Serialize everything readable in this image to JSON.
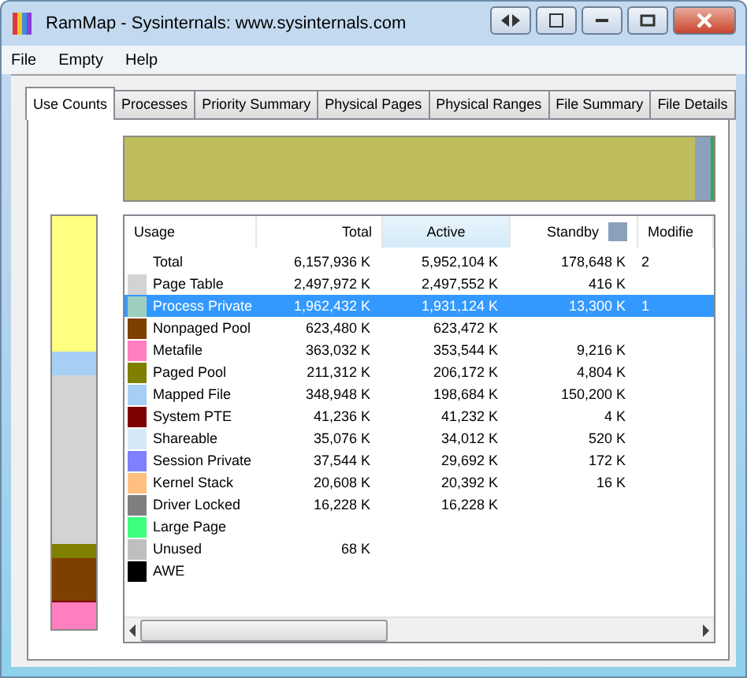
{
  "window": {
    "title": "RamMap - Sysinternals: www.sysinternals.com"
  },
  "menu": [
    "File",
    "Empty",
    "Help"
  ],
  "tabs": [
    {
      "label": "Use Counts",
      "selected": true
    },
    {
      "label": "Processes",
      "selected": false
    },
    {
      "label": "Priority Summary",
      "selected": false
    },
    {
      "label": "Physical Pages",
      "selected": false
    },
    {
      "label": "Physical Ranges",
      "selected": false
    },
    {
      "label": "File Summary",
      "selected": false
    },
    {
      "label": "File Details",
      "selected": false
    }
  ],
  "table": {
    "columns": [
      "Usage",
      "Total",
      "Active",
      "Standby",
      "Modifie"
    ],
    "rows": [
      {
        "usage": "Total",
        "total": "6,157,936 K",
        "active": "5,952,104 K",
        "standby": "178,648 K",
        "column_5": "2",
        "selected": false
      },
      {
        "usage": "Page Table",
        "color": "#d3d3d3",
        "total": "2,497,972 K",
        "active": "2,497,552 K",
        "standby": "416 K",
        "selected": false
      },
      {
        "usage": "Process Private",
        "color": "#9ccfbf",
        "total": "1,962,432 K",
        "active": "1,931,124 K",
        "standby": "13,300 K",
        "column_5": "1",
        "selected": true
      },
      {
        "usage": "Nonpaged Pool",
        "color": "#7f3f00",
        "total": "623,480 K",
        "active": "623,472 K",
        "selected": false
      },
      {
        "usage": "Metafile",
        "color": "#ff7fbf",
        "total": "363,032 K",
        "active": "353,544 K",
        "standby": "9,216 K",
        "selected": false
      },
      {
        "usage": "Paged Pool",
        "color": "#7f7f00",
        "total": "211,312 K",
        "active": "206,172 K",
        "standby": "4,804 K",
        "selected": false
      },
      {
        "usage": "Mapped File",
        "color": "#a6cff5",
        "total": "348,948 K",
        "active": "198,684 K",
        "standby": "150,200 K",
        "selected": false
      },
      {
        "usage": "System PTE",
        "color": "#7f0000",
        "total": "41,236 K",
        "active": "41,232 K",
        "standby": "4 K",
        "selected": false
      },
      {
        "usage": "Shareable",
        "color": "#d6e8f8",
        "total": "35,076 K",
        "active": "34,012 K",
        "standby": "520 K",
        "selected": false
      },
      {
        "usage": "Session Private",
        "color": "#7f7fff",
        "total": "37,544 K",
        "active": "29,692 K",
        "standby": "172 K",
        "selected": false
      },
      {
        "usage": "Kernel Stack",
        "color": "#ffbf7f",
        "total": "20,608 K",
        "active": "20,392 K",
        "standby": "16 K",
        "selected": false
      },
      {
        "usage": "Driver Locked",
        "color": "#7f7f7f",
        "total": "16,228 K",
        "active": "16,228 K",
        "selected": false
      },
      {
        "usage": "Large Page",
        "color": "#3fff7f",
        "selected": false
      },
      {
        "usage": "Unused",
        "color": "#bfbfbf",
        "total": "68 K",
        "selected": false
      },
      {
        "usage": "AWE",
        "color": "#000000",
        "selected": false
      }
    ]
  }
}
